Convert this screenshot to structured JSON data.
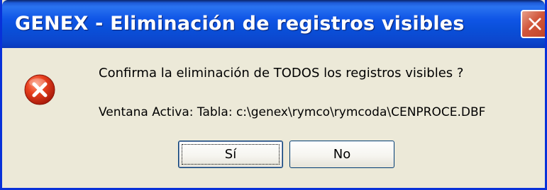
{
  "window": {
    "title": "GENEX - Eliminación de registros visibles",
    "close_icon": "close-icon"
  },
  "dialog": {
    "icon": "error-icon",
    "message": "Confirma la eliminación de TODOS los registros visibles ?",
    "detail": "Ventana Activa: Tabla: c:\\genex\\rymco\\rymcoda\\CENPROCE.DBF"
  },
  "buttons": {
    "yes_label": "Sí",
    "no_label": "No"
  },
  "colors": {
    "titlebar": "#0a4fd8",
    "dialog_background": "#ece9d8",
    "error_red": "#e03a1c",
    "button_border": "#003c74"
  }
}
